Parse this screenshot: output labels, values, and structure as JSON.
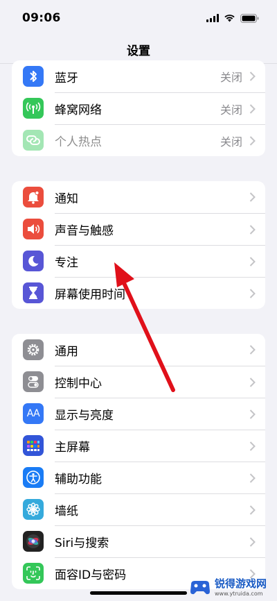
{
  "status": {
    "time": "09:06"
  },
  "nav": {
    "title": "设置"
  },
  "group1": [
    {
      "label": "蓝牙",
      "value": "关闭",
      "icon": "bluetooth-icon",
      "color": "#3478f6"
    },
    {
      "label": "蜂窝网络",
      "value": "关闭",
      "icon": "antenna-icon",
      "color": "#34c759"
    },
    {
      "label": "个人热点",
      "value": "关闭",
      "icon": "hotspot-link-icon",
      "color": "#34c759"
    }
  ],
  "group2": [
    {
      "label": "通知",
      "icon": "bell-icon",
      "color": "#eb4d3d"
    },
    {
      "label": "声音与触感",
      "icon": "speaker-icon",
      "color": "#eb4d3d"
    },
    {
      "label": "专注",
      "icon": "moon-icon",
      "color": "#5856d6"
    },
    {
      "label": "屏幕使用时间",
      "icon": "hourglass-icon",
      "color": "#5856d6"
    }
  ],
  "group3": [
    {
      "label": "通用",
      "icon": "gear-icon",
      "color": "#8e8e93"
    },
    {
      "label": "控制中心",
      "icon": "toggles-icon",
      "color": "#8e8e93"
    },
    {
      "label": "显示与亮度",
      "icon": "aa-text-icon",
      "color": "#3478f6"
    },
    {
      "label": "主屏幕",
      "icon": "app-grid-icon",
      "color": "#3255d8"
    },
    {
      "label": "辅助功能",
      "icon": "accessibility-icon",
      "color": "#1a7cf5"
    },
    {
      "label": "墙纸",
      "icon": "flower-icon",
      "color": "#35aadc"
    },
    {
      "label": "Siri与搜索",
      "icon": "siri-icon",
      "color": "#222"
    },
    {
      "label": "面容ID与密码",
      "icon": "face-id-icon",
      "color": "#34c759"
    }
  ],
  "aa_glyph": "AA",
  "watermark": {
    "text": "锐得游戏网",
    "url": "www.ytruida.com"
  }
}
